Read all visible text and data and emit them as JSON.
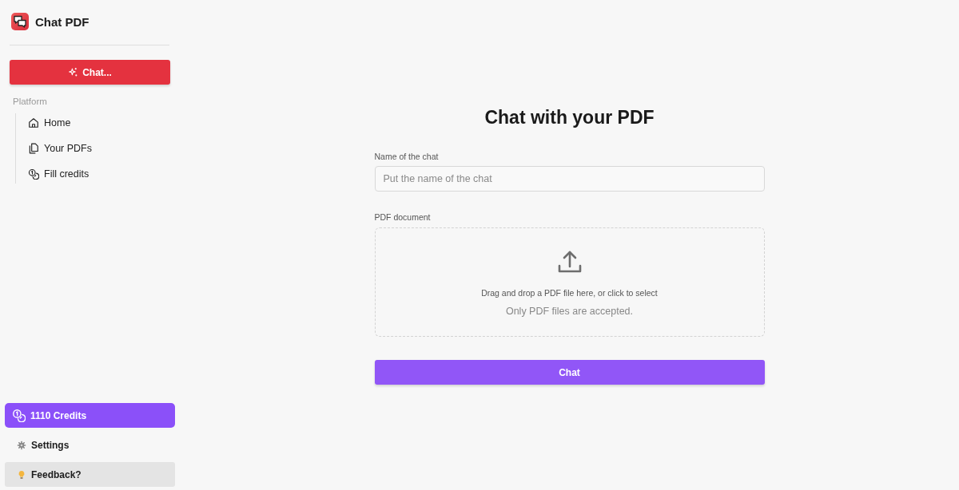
{
  "app": {
    "name": "Chat PDF"
  },
  "sidebar": {
    "new_chat_button": "Chat...",
    "section_label": "Platform",
    "items": [
      {
        "label": "Home",
        "kind": "home"
      },
      {
        "label": "Your PDFs",
        "kind": "files"
      },
      {
        "label": "Fill credits",
        "kind": "coins"
      }
    ],
    "credits_button": "1110 Credits",
    "footer_items": [
      {
        "label": "Settings",
        "kind": "settings",
        "selected": false
      },
      {
        "label": "Feedback?",
        "kind": "feedback",
        "selected": true
      }
    ]
  },
  "form": {
    "title": "Chat with your PDF",
    "name_field": {
      "label": "Name of the chat",
      "placeholder": "Put the name of the chat"
    },
    "document_field": {
      "label": "PDF document",
      "dropzone_text": "Drag and drop a PDF file here, or click to select",
      "hint": "Only PDF files are accepted."
    },
    "submit_button": "Chat"
  }
}
